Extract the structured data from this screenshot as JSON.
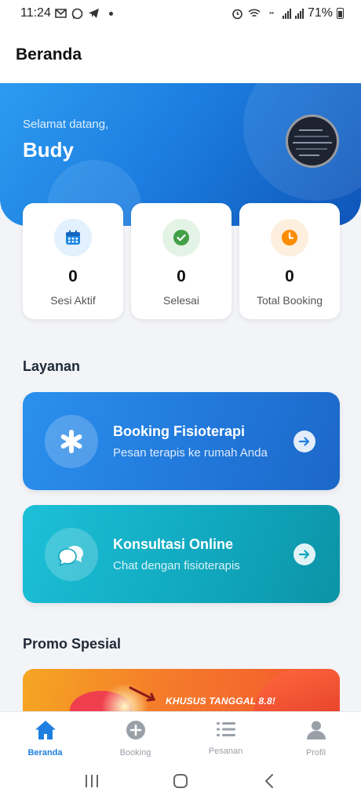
{
  "status_bar": {
    "time": "11:24",
    "battery": "71%"
  },
  "header": {
    "title": "Beranda"
  },
  "hero": {
    "greeting": "Selamat datang,",
    "name": "Budy"
  },
  "stats": [
    {
      "value": "0",
      "label": "Sesi Aktif",
      "icon": "calendar-icon",
      "color": "#1e88e5"
    },
    {
      "value": "0",
      "label": "Selesai",
      "icon": "check-circle-icon",
      "color": "#43a047"
    },
    {
      "value": "0",
      "label": "Total Booking",
      "icon": "clock-icon",
      "color": "#fb8c00"
    }
  ],
  "services_title": "Layanan",
  "services": [
    {
      "title": "Booking Fisioterapi",
      "subtitle": "Pesan terapis ke rumah Anda",
      "icon": "asterisk-icon"
    },
    {
      "title": "Konsultasi Online",
      "subtitle": "Chat dengan fisioterapis",
      "icon": "chat-bubbles-icon"
    }
  ],
  "promo_title": "Promo Spesial",
  "promo": {
    "text": "KHUSUS TANGGAL 8.8!"
  },
  "nav": [
    {
      "label": "Beranda",
      "icon": "home-icon",
      "active": true
    },
    {
      "label": "Booking",
      "icon": "plus-circle-icon",
      "active": false
    },
    {
      "label": "Pesanan",
      "icon": "list-icon",
      "active": false
    },
    {
      "label": "Profil",
      "icon": "user-icon",
      "active": false
    }
  ],
  "colors": {
    "primary": "#1f7fe0",
    "teal": "#10a7bd",
    "inactive": "#9aa0a8"
  }
}
